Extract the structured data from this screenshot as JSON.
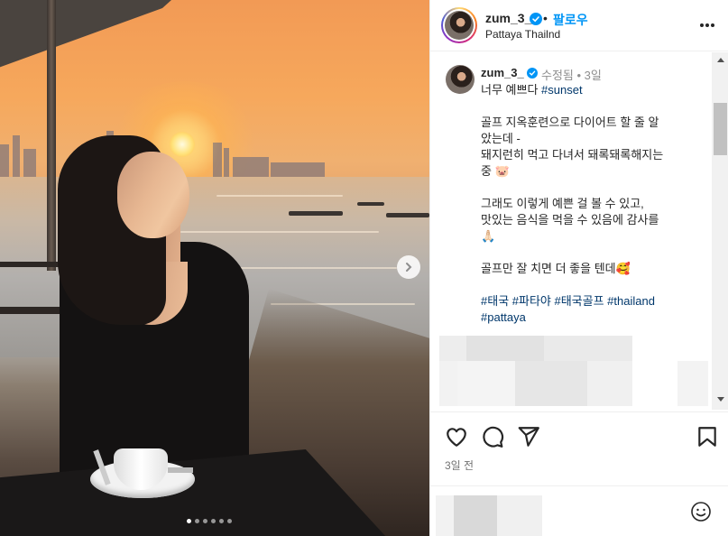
{
  "post": {
    "username": "zum_3_",
    "follow_separator": "•",
    "follow_label": "팔로우",
    "location": "Pattaya Thailnd"
  },
  "caption": {
    "username": "zum_3_",
    "edited_label": "수정됨 • 3일",
    "lines": [
      {
        "text": "너무 예쁘다 ",
        "tag": "#sunset"
      },
      {
        "text": ""
      },
      {
        "text": "골프 지옥훈련으로 다이어트 할 줄 알"
      },
      {
        "text": "았는데 -"
      },
      {
        "text": "돼지런히 먹고 다녀서 돼록돼록해지는"
      },
      {
        "text": "중 🐷"
      },
      {
        "text": ""
      },
      {
        "text": "그래도 이렇게 예쁜 걸 볼 수 있고,"
      },
      {
        "text": "맛있는 음식을 먹을 수 있음에 감사를"
      },
      {
        "text": "🙏🏻"
      },
      {
        "text": ""
      },
      {
        "text": "골프만 잘 치면 더 좋을 텐데🥰"
      },
      {
        "text": ""
      },
      {
        "text": "",
        "tag": "#태국 #파타야 #태국골프 #thailand"
      },
      {
        "text": "",
        "tag": "#pattaya"
      }
    ]
  },
  "actions": {
    "like_icon": "heart-outline-icon",
    "comment_icon": "speech-bubble-icon",
    "share_icon": "paper-plane-icon",
    "save_icon": "bookmark-icon"
  },
  "time_ago": "3일 전",
  "carousel": {
    "count": 6,
    "active": 0
  },
  "colors": {
    "follow": "#0095f6",
    "hashtag": "#00376b",
    "verified": "#0095f6"
  }
}
